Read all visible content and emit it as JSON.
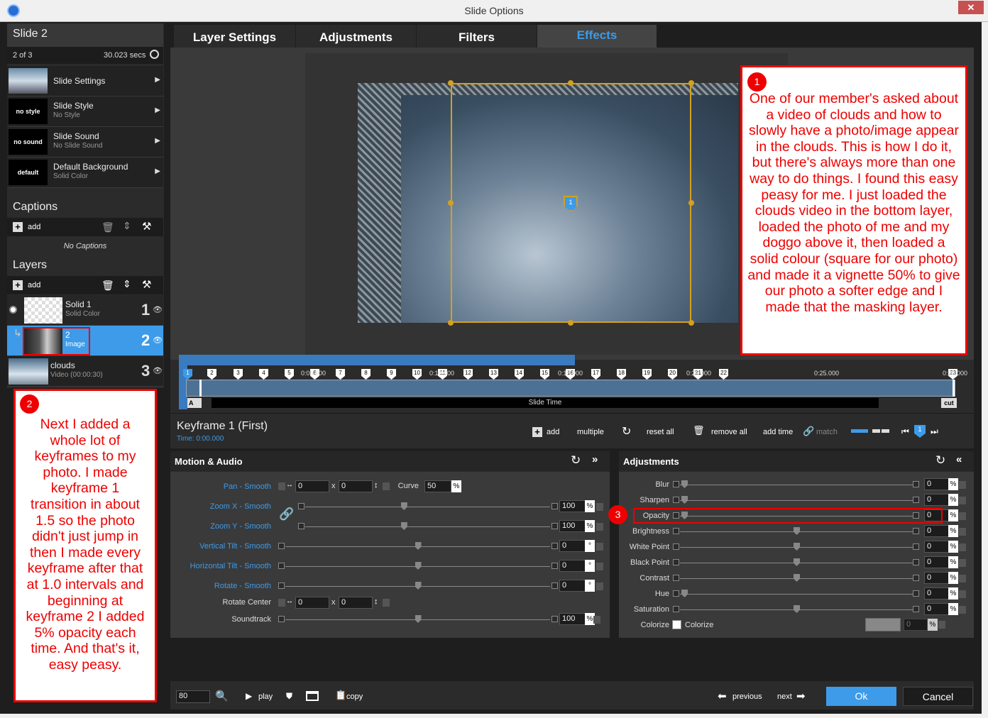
{
  "window": {
    "title": "Slide Options",
    "close": "✕"
  },
  "left": {
    "slide_title": "Slide 2",
    "slide_count": "2 of 3",
    "slide_duration": "30.023 secs",
    "menu": [
      {
        "title": "Slide Settings",
        "sub": "",
        "thumb": ""
      },
      {
        "title": "Slide Style",
        "sub": "No Style",
        "thumb": "no style"
      },
      {
        "title": "Slide Sound",
        "sub": "No Slide Sound",
        "thumb": "no sound"
      },
      {
        "title": "Default Background",
        "sub": "Solid Color",
        "thumb": "default"
      }
    ],
    "captions_header": "Captions",
    "add_label": "add",
    "no_captions": "No Captions",
    "layers_header": "Layers",
    "layers": [
      {
        "name": "Solid 1",
        "sub": "Solid Color",
        "num": "1"
      },
      {
        "name": "2",
        "sub": "Image",
        "num": "2"
      },
      {
        "name": "clouds",
        "sub": "Video (00:00:30)",
        "num": "3"
      }
    ]
  },
  "tabs": [
    "Layer Settings",
    "Adjustments",
    "Filters",
    "Effects"
  ],
  "annotations": {
    "a1": {
      "num": "1",
      "text": "One of our member's asked about a video of clouds and how to slowly have a photo/image appear in the clouds. This is how I do it, but there's always more than one way to do things. I found this easy peasy for me. I just loaded the clouds video in the bottom layer, loaded the photo of me and my doggo above it, then loaded a solid colour (square for our photo) and made it a vignette 50% to give our photo a softer edge and I made that the masking layer."
    },
    "a2": {
      "num": "2",
      "text": "Next I added a whole lot of keyframes to my photo. I made keyframe 1 transition in about 1.5 so the photo didn't just jump in then I made every keyframe after that at 1.0 intervals and beginning at keyframe 2 I added 5% opacity each time. And that's it, easy peasy."
    },
    "a3": {
      "num": "3"
    }
  },
  "canvas": {
    "center_marker": "1"
  },
  "timeline": {
    "keyframes": [
      "1",
      "2",
      "3",
      "4",
      "5",
      "6",
      "7",
      "8",
      "9",
      "10",
      "11",
      "12",
      "13",
      "14",
      "15",
      "16",
      "17",
      "18",
      "19",
      "20",
      "21",
      "22",
      "23"
    ],
    "times": [
      "0:05.000",
      "0:10.000",
      "0:15.000",
      "0:20.000",
      "0:25.000",
      "0:30.000"
    ],
    "slide_time": "Slide Time",
    "start_tag": "A",
    "cut": "cut"
  },
  "keyframe_info": {
    "title": "Keyframe 1 (First)",
    "time": "Time: 0:00.000"
  },
  "kf_tools": {
    "add": "add",
    "multiple": "multiple",
    "reset_all": "reset all",
    "remove_all": "remove all",
    "add_time": "add time",
    "match": "match",
    "current": "1"
  },
  "motion": {
    "header": "Motion & Audio",
    "pan": {
      "label": "Pan - Smooth",
      "x": "0",
      "y": "0",
      "sep": "x"
    },
    "curve": {
      "label": "Curve",
      "value": "50",
      "unit": "%"
    },
    "zoomx": {
      "label": "Zoom X - Smooth",
      "value": "100",
      "unit": "%",
      "level": 0.4
    },
    "zoomy": {
      "label": "Zoom Y - Smooth",
      "value": "100",
      "unit": "%",
      "level": 0.4
    },
    "vtilt": {
      "label": "Vertical Tilt - Smooth",
      "value": "0",
      "unit": "°",
      "level": 0.5
    },
    "htilt": {
      "label": "Horizontal Tilt - Smooth",
      "value": "0",
      "unit": "°",
      "level": 0.5
    },
    "rotate": {
      "label": "Rotate - Smooth",
      "value": "0",
      "unit": "°",
      "level": 0.5
    },
    "rcenter": {
      "label": "Rotate Center",
      "x": "0",
      "y": "0",
      "sep": "x"
    },
    "soundtrack": {
      "label": "Soundtrack",
      "value": "100",
      "unit": "%",
      "level": 0.5
    }
  },
  "adjust": {
    "header": "Adjustments",
    "rows": [
      {
        "label": "Blur",
        "value": "0",
        "level": 0.0
      },
      {
        "label": "Sharpen",
        "value": "0",
        "level": 0.0
      },
      {
        "label": "Opacity",
        "value": "0",
        "level": 0.0
      },
      {
        "label": "Brightness",
        "value": "0",
        "level": 0.5
      },
      {
        "label": "White Point",
        "value": "0",
        "level": 0.5
      },
      {
        "label": "Black Point",
        "value": "0",
        "level": 0.5
      },
      {
        "label": "Contrast",
        "value": "0",
        "level": 0.5
      },
      {
        "label": "Hue",
        "value": "0",
        "level": 0.0
      },
      {
        "label": "Saturation",
        "value": "0",
        "level": 0.5
      }
    ],
    "unit": "%",
    "colorize_label": "Colorize",
    "colorize_check": "Colorize",
    "colorize_value": "0"
  },
  "bottom": {
    "zoom": "80",
    "play": "play",
    "copy": "copy",
    "previous": "previous",
    "next": "next",
    "ok": "Ok",
    "cancel": "Cancel"
  },
  "colors": {
    "accent": "#3d9be9",
    "annotation": "#e00000",
    "selected_layer": "#3d9be9"
  }
}
